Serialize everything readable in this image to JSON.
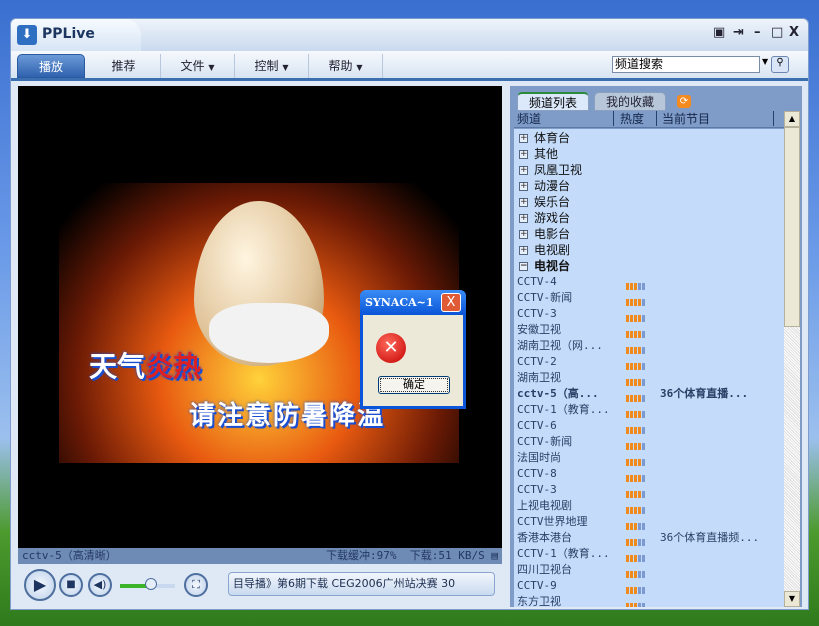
{
  "window": {
    "title": "PPLive",
    "controls": [
      "▣",
      "⇥",
      "–",
      "□",
      "X"
    ]
  },
  "menu": {
    "items": [
      {
        "label": "播放",
        "arrow": ""
      },
      {
        "label": "推荐",
        "arrow": ""
      },
      {
        "label": "文件",
        "arrow": "▼"
      },
      {
        "label": "控制",
        "arrow": "▼"
      },
      {
        "label": "帮助",
        "arrow": "▼"
      }
    ],
    "search_value": "频道搜索"
  },
  "video": {
    "line1a": "天气",
    "line1b": "炎热",
    "line2": "请注意防暑降温"
  },
  "status": {
    "channel": "cctv-5（高清晰）",
    "buffer": "下载缓冲:97%",
    "speed": "下载:51 KB/S"
  },
  "player": {
    "marquee": "目导播》第6期下载    CEG2006广州站决赛    30",
    "volume": 0.55
  },
  "panel": {
    "tabs": [
      "频道列表",
      "我的收藏"
    ],
    "columns": [
      "频道",
      "热度",
      "当前节目"
    ]
  },
  "categories": [
    {
      "name": "体育台",
      "sign": "+"
    },
    {
      "name": "其他",
      "sign": "+"
    },
    {
      "name": "凤凰卫视",
      "sign": "+"
    },
    {
      "name": "动漫台",
      "sign": "+"
    },
    {
      "name": "娱乐台",
      "sign": "+"
    },
    {
      "name": "游戏台",
      "sign": "+"
    },
    {
      "name": "电影台",
      "sign": "+"
    },
    {
      "name": "电视剧",
      "sign": "+"
    },
    {
      "name": "电视台",
      "sign": "−"
    }
  ],
  "channels": [
    {
      "name": "CCTV-4",
      "heat": 2,
      "program": ""
    },
    {
      "name": "CCTV-新闻",
      "heat": 4,
      "program": ""
    },
    {
      "name": "CCTV-3",
      "heat": 4,
      "program": ""
    },
    {
      "name": "安徽卫视",
      "heat": 4,
      "program": ""
    },
    {
      "name": "湖南卫视（网...",
      "heat": 3,
      "program": ""
    },
    {
      "name": "CCTV-2",
      "heat": 3,
      "program": ""
    },
    {
      "name": "湖南卫视",
      "heat": 3,
      "program": ""
    },
    {
      "name": "cctv-5（高...",
      "heat": 3,
      "program": "36个体育直播...",
      "bold": true
    },
    {
      "name": "CCTV-1（教育...",
      "heat": 3,
      "program": ""
    },
    {
      "name": "CCTV-6",
      "heat": 3,
      "program": ""
    },
    {
      "name": "CCTV-新闻",
      "heat": 3,
      "program": ""
    },
    {
      "name": "法国时尚",
      "heat": 3,
      "program": ""
    },
    {
      "name": "CCTV-8",
      "heat": 3,
      "program": ""
    },
    {
      "name": "CCTV-3",
      "heat": 3,
      "program": ""
    },
    {
      "name": "上视电视剧",
      "heat": 3,
      "program": ""
    },
    {
      "name": "CCTV世界地理",
      "heat": 2,
      "program": ""
    },
    {
      "name": "香港本港台",
      "heat": 2,
      "program": "36个体育直播频..."
    },
    {
      "name": "CCTV-1（教育...",
      "heat": 2,
      "program": ""
    },
    {
      "name": "四川卫视台",
      "heat": 2,
      "program": ""
    },
    {
      "name": "CCTV-9",
      "heat": 2,
      "program": ""
    },
    {
      "name": "东方卫视",
      "heat": 2,
      "program": ""
    }
  ],
  "dialog": {
    "title": "SYNACA~1",
    "ok": "确定",
    "close": "X",
    "icon": "✕"
  }
}
